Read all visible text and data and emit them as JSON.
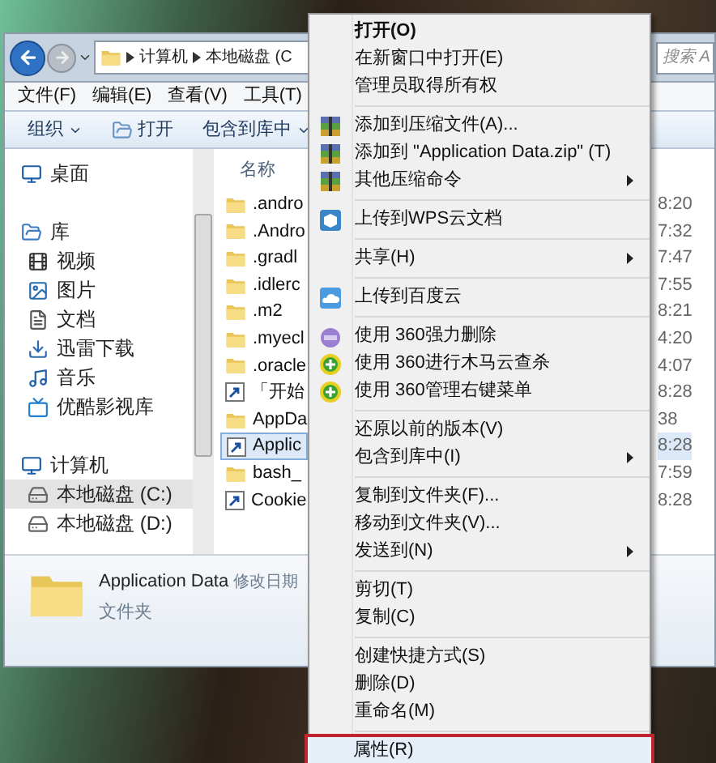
{
  "nav": {
    "path": [
      "计算机",
      "本地磁盘 (C"
    ],
    "search_placeholder": "搜索 A"
  },
  "menu_bar": [
    "文件(F)",
    "编辑(E)",
    "查看(V)",
    "工具(T)"
  ],
  "toolbar": [
    {
      "label": "组织",
      "kind": "dropdown"
    },
    {
      "label": "打开",
      "kind": "open"
    },
    {
      "label": "包含到库中",
      "kind": "dropdown"
    }
  ],
  "sidebar": {
    "items": [
      {
        "label": "桌面",
        "selected": false
      },
      {
        "label": "库",
        "selected": false,
        "children": [
          {
            "label": "视频",
            "selected": false
          },
          {
            "label": "图片",
            "selected": false
          },
          {
            "label": "文档",
            "selected": false
          },
          {
            "label": "迅雷下载",
            "selected": false
          },
          {
            "label": "音乐",
            "selected": false
          },
          {
            "label": "优酷影视库",
            "selected": false
          }
        ]
      },
      {
        "label": "计算机",
        "selected": false,
        "children": [
          {
            "label": "本地磁盘 (C:)",
            "selected": true
          },
          {
            "label": "本地磁盘 (D:)",
            "selected": false
          }
        ]
      }
    ]
  },
  "file_list": {
    "column_name": "名称",
    "rows": [
      {
        "name": ".andro",
        "kind": "folder",
        "time": "8:20",
        "selected": false
      },
      {
        "name": ".Andro",
        "kind": "folder",
        "time": "7:32",
        "selected": false
      },
      {
        "name": ".gradl",
        "kind": "folder",
        "time": "7:47",
        "selected": false
      },
      {
        "name": ".idlerc",
        "kind": "folder",
        "time": "7:55",
        "selected": false
      },
      {
        "name": ".m2",
        "kind": "folder",
        "time": "8:21",
        "selected": false
      },
      {
        "name": ".myecl",
        "kind": "folder",
        "time": "4:20",
        "selected": false
      },
      {
        "name": ".oracle",
        "kind": "folder",
        "time": "4:07",
        "selected": false
      },
      {
        "name": "「开始",
        "kind": "shortcut",
        "time": "8:28",
        "selected": false
      },
      {
        "name": "AppDa",
        "kind": "folder",
        "time": "38",
        "selected": false
      },
      {
        "name": "Applic",
        "kind": "shortcut",
        "time": "8:28",
        "selected": true
      },
      {
        "name": "bash_",
        "kind": "folder",
        "time": "7:59",
        "selected": false
      },
      {
        "name": "Cookie",
        "kind": "shortcut",
        "time": "8:28",
        "selected": false
      }
    ]
  },
  "details": {
    "name": "Application Data",
    "field": "修改日期",
    "type": "文件夹"
  },
  "context_menu": {
    "groups": [
      [
        {
          "label": "打开(O)",
          "kind": "default",
          "submenu": false,
          "selected": false
        },
        {
          "label": "在新窗口中打开(E)",
          "kind": "normal",
          "submenu": false,
          "selected": false
        },
        {
          "label": "管理员取得所有权",
          "kind": "normal",
          "submenu": false,
          "selected": false
        }
      ],
      [
        {
          "label": "添加到压缩文件(A)...",
          "kind": "archive",
          "submenu": false,
          "selected": false
        },
        {
          "label": "添加到 \"Application Data.zip\" (T)",
          "kind": "archive",
          "submenu": false,
          "selected": false
        },
        {
          "label": "其他压缩命令",
          "kind": "archive",
          "submenu": true,
          "selected": false
        }
      ],
      [
        {
          "label": "上传到WPS云文档",
          "kind": "cube",
          "submenu": false,
          "selected": false
        }
      ],
      [
        {
          "label": "共享(H)",
          "kind": "normal",
          "submenu": true,
          "selected": false
        }
      ],
      [
        {
          "label": "上传到百度云",
          "kind": "cloud",
          "submenu": false,
          "selected": false
        }
      ],
      [
        {
          "label": "使用 360强力删除",
          "kind": "blob",
          "submenu": false,
          "selected": false
        },
        {
          "label": "使用 360进行木马云查杀",
          "kind": "plus",
          "submenu": false,
          "selected": false
        },
        {
          "label": "使用 360管理右键菜单",
          "kind": "plus",
          "submenu": false,
          "selected": false
        }
      ],
      [
        {
          "label": "还原以前的版本(V)",
          "kind": "normal",
          "submenu": false,
          "selected": false
        },
        {
          "label": "包含到库中(I)",
          "kind": "normal",
          "submenu": true,
          "selected": false
        }
      ],
      [
        {
          "label": "复制到文件夹(F)...",
          "kind": "normal",
          "submenu": false,
          "selected": false
        },
        {
          "label": "移动到文件夹(V)...",
          "kind": "normal",
          "submenu": false,
          "selected": false
        },
        {
          "label": "发送到(N)",
          "kind": "normal",
          "submenu": true,
          "selected": false
        }
      ],
      [
        {
          "label": "剪切(T)",
          "kind": "normal",
          "submenu": false,
          "selected": false
        },
        {
          "label": "复制(C)",
          "kind": "normal",
          "submenu": false,
          "selected": false
        }
      ],
      [
        {
          "label": "创建快捷方式(S)",
          "kind": "normal",
          "submenu": false,
          "selected": false
        },
        {
          "label": "删除(D)",
          "kind": "normal",
          "submenu": false,
          "selected": false
        },
        {
          "label": "重命名(M)",
          "kind": "normal",
          "submenu": false,
          "selected": false
        }
      ],
      [
        {
          "label": "属性(R)",
          "kind": "normal",
          "submenu": false,
          "selected": true
        }
      ]
    ]
  }
}
